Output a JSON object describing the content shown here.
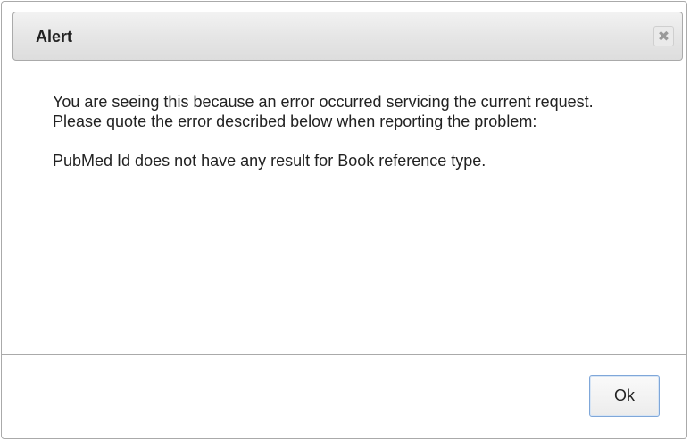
{
  "dialog": {
    "title": "Alert",
    "close_icon": "close-icon",
    "message_lines": [
      "You are seeing this because an error occurred servicing the current request.",
      "Please quote the error described below when reporting the problem:",
      "PubMed Id does not have any result for Book reference type."
    ],
    "ok_label": "Ok"
  },
  "colors": {
    "titlebar_top": "#f2f2f2",
    "titlebar_bottom": "#dddddd",
    "border": "#aaaaaa",
    "ok_border": "#7fa7d9",
    "text": "#222222"
  }
}
